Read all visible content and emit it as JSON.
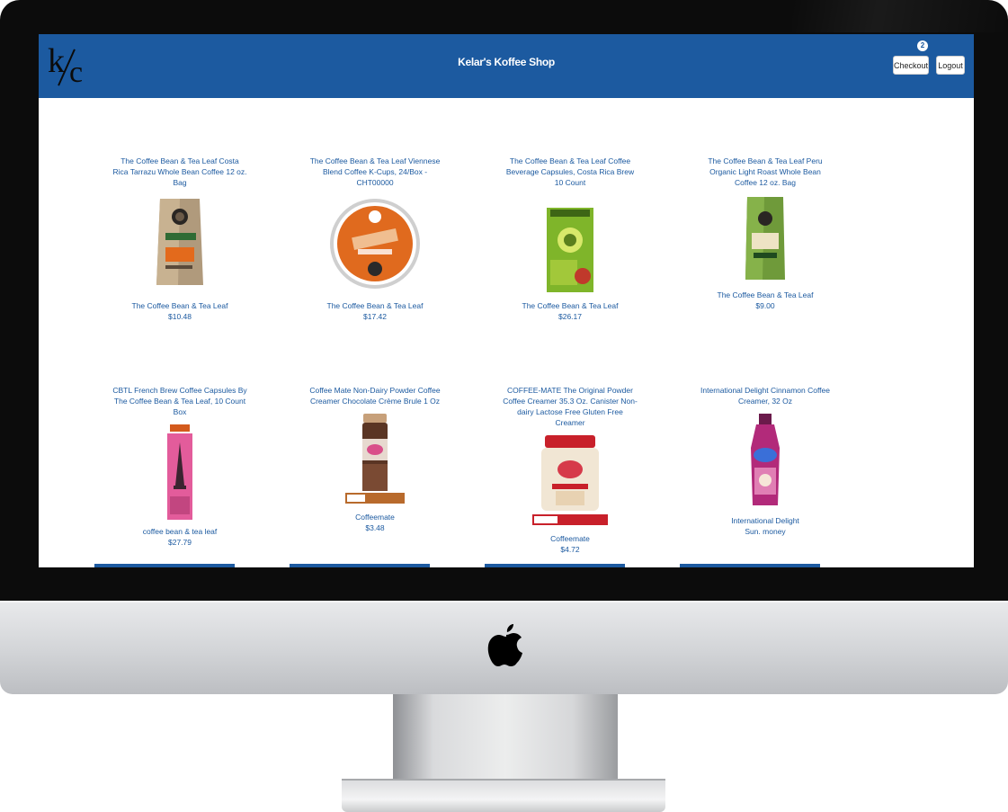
{
  "app": {
    "title": "Kelar's Koffee Shop",
    "logo": "k/c",
    "cart_count": "2",
    "checkout_label": "Checkout",
    "logout_label": "Logout"
  },
  "colors": {
    "navbar": "#1c5aa0",
    "link": "#1c5aa0"
  },
  "products": [
    {
      "name": "The Coffee Bean & Tea Leaf Costa Rica Tarrazu Whole Bean Coffee 12 oz. Bag",
      "brand": "The Coffee Bean & Tea Leaf",
      "price": "$10.48",
      "image_icon": "coffee-bag-icon"
    },
    {
      "name": "The Coffee Bean & Tea Leaf Viennese Blend Coffee K-Cups, 24/Box - CHT00000",
      "brand": "The Coffee Bean & Tea Leaf",
      "price": "$17.42",
      "image_icon": "k-cup-icon"
    },
    {
      "name": "The Coffee Bean & Tea Leaf Coffee Beverage Capsules, Costa Rica Brew 10 Count",
      "brand": "The Coffee Bean & Tea Leaf",
      "price": "$26.17",
      "image_icon": "capsule-box-icon"
    },
    {
      "name": "The Coffee Bean & Tea Leaf Peru Organic Light Roast Whole Bean Coffee 12 oz. Bag",
      "brand": "The Coffee Bean & Tea Leaf",
      "price": "$9.00",
      "image_icon": "coffee-bag-icon"
    },
    {
      "name": "CBTL French Brew Coffee Capsules By The Coffee Bean & Tea Leaf, 10 Count Box",
      "brand": "coffee bean & tea leaf",
      "price": "$27.79",
      "image_icon": "capsule-box-icon"
    },
    {
      "name": "Coffee Mate Non-Dairy Powder Coffee Creamer Chocolate Crème Brule 1 Oz",
      "brand": "Coffeemate",
      "price": "$3.48",
      "image_icon": "creamer-canister-icon"
    },
    {
      "name": "COFFEE-MATE The Original Powder Coffee Creamer 35.3 Oz. Canister Non-dairy Lactose Free Gluten Free Creamer",
      "brand": "Coffeemate",
      "price": "$4.72",
      "image_icon": "creamer-canister-icon"
    },
    {
      "name": "International Delight Cinnamon Coffee Creamer, 32 Oz",
      "brand": "International Delight",
      "price": "Sun. money",
      "image_icon": "creamer-bottle-icon"
    }
  ]
}
